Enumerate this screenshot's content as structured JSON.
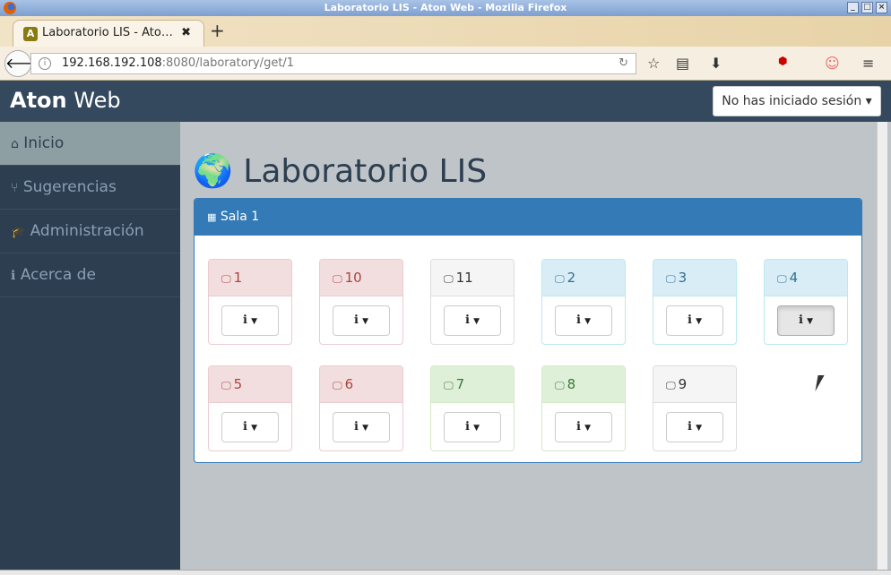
{
  "window": {
    "title": "Laboratorio LIS - Aton Web - Mozilla Firefox"
  },
  "browser": {
    "tab_title": "Laboratorio LIS - Ato…",
    "url_host": "192.168.192.108",
    "url_rest": ":8080/laboratory/get/1"
  },
  "app": {
    "brand_bold": "Aton",
    "brand_rest": "Web",
    "login_label": "No has iniciado sesión ▾"
  },
  "sidebar": {
    "items": [
      {
        "icon": "⌂",
        "label": "Inicio"
      },
      {
        "icon": "⑂",
        "label": "Sugerencias"
      },
      {
        "icon": "🎓",
        "label": "Administración"
      },
      {
        "icon": "ℹ",
        "label": "Acerca de"
      }
    ]
  },
  "main": {
    "title": "Laboratorio LIS",
    "room": "Sala 1",
    "computers": [
      {
        "label": "1",
        "state": "danger"
      },
      {
        "label": "10",
        "state": "danger"
      },
      {
        "label": "11",
        "state": "default"
      },
      {
        "label": "2",
        "state": "info"
      },
      {
        "label": "3",
        "state": "info"
      },
      {
        "label": "4",
        "state": "info"
      },
      {
        "label": "5",
        "state": "danger"
      },
      {
        "label": "6",
        "state": "danger"
      },
      {
        "label": "7",
        "state": "success"
      },
      {
        "label": "8",
        "state": "success"
      },
      {
        "label": "9",
        "state": "default"
      }
    ]
  }
}
